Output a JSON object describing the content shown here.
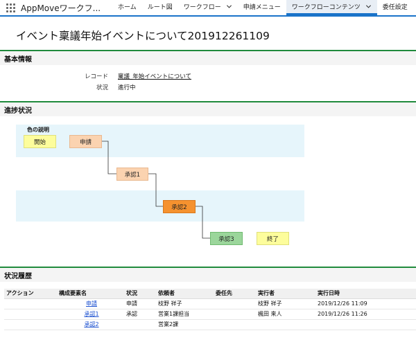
{
  "nav": {
    "app_name": "AppMoveワークフ...",
    "items": [
      {
        "label": "ホーム",
        "active": false,
        "dropdown": false
      },
      {
        "label": "ルート図",
        "active": false,
        "dropdown": false
      },
      {
        "label": "ワークフロー",
        "active": false,
        "dropdown": true
      },
      {
        "label": "申請メニュー",
        "active": false,
        "dropdown": false
      },
      {
        "label": "ワークフローコンテンツ",
        "active": true,
        "dropdown": true
      },
      {
        "label": "委任設定",
        "active": false,
        "dropdown": false
      }
    ]
  },
  "page": {
    "title": "イベント稟議年始イベントについて201912261109"
  },
  "basic_info": {
    "heading": "基本情報",
    "record_label": "レコード",
    "record_value": "稟議_年始イベントについて",
    "status_label": "状況",
    "status_value": "進行中"
  },
  "progress": {
    "heading": "進捗状況",
    "legend_title": "色の説明",
    "nodes": {
      "start": "開始",
      "apply": "申請",
      "approve1": "承認1",
      "approve2": "承認2",
      "approve3": "承認3",
      "end": "終了"
    }
  },
  "history": {
    "heading": "状況履歴",
    "columns": [
      "アクション",
      "構成要素名",
      "状況",
      "依頼者",
      "委任先",
      "実行者",
      "実行日時"
    ],
    "rows": [
      {
        "action": "",
        "element": "申請",
        "status": "申請",
        "requester": "枝野 祥子",
        "delegate": "",
        "executor": "枝野 祥子",
        "datetime": "2019/12/26 11:09"
      },
      {
        "action": "",
        "element": "承認1",
        "status": "承認",
        "requester": "営業1課担当",
        "delegate": "",
        "executor": "楓田 来人",
        "datetime": "2019/12/26 11:26"
      },
      {
        "action": "",
        "element": "承認2",
        "status": "",
        "requester": "営業2課",
        "delegate": "",
        "executor": "",
        "datetime": ""
      }
    ]
  },
  "colors": {
    "accent": "#1a73c9",
    "section_line": "#1f8a3c",
    "start_end": "#fdfd9c",
    "applied": "#fbd3b0",
    "current": "#f5922f",
    "pending": "#9bd69b",
    "band": "#e6f5fb"
  }
}
